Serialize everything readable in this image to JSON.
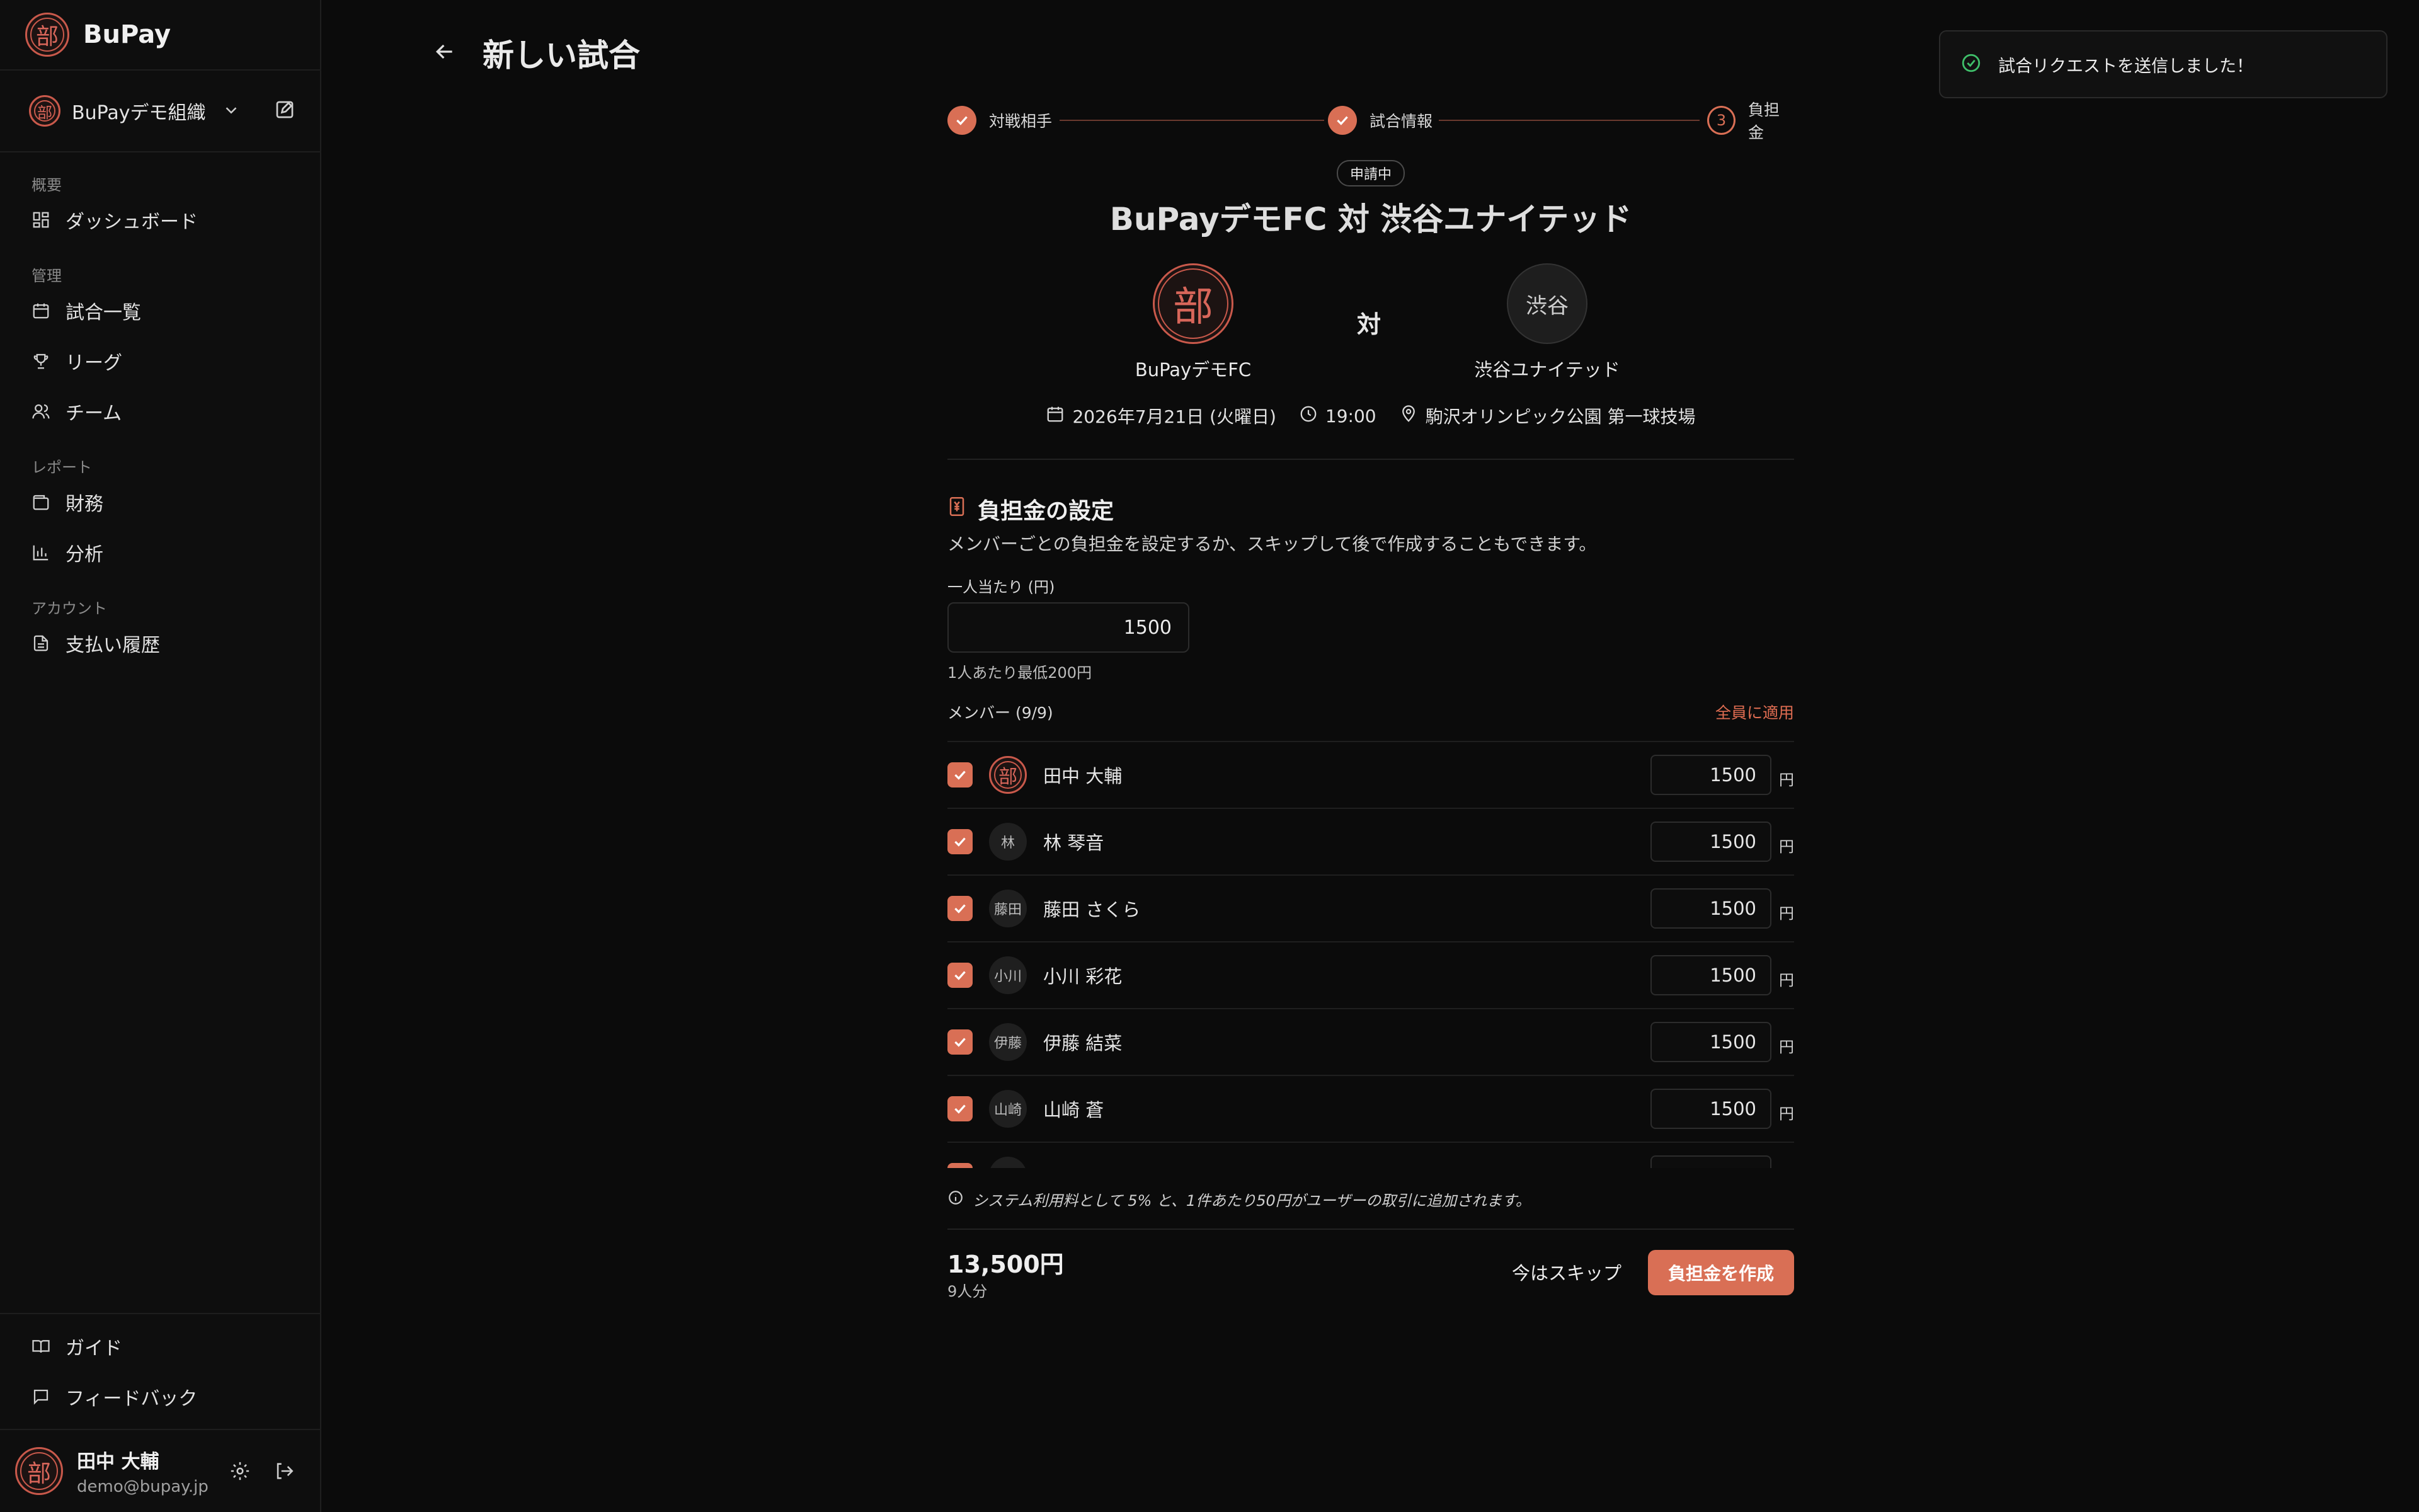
{
  "app": {
    "brand": "BuPay",
    "logo_char": "部"
  },
  "sidebar": {
    "org_name": "BuPayデモ組織",
    "sections": {
      "overview": "概要",
      "manage": "管理",
      "report": "レポート",
      "account": "アカウント"
    },
    "items": {
      "dashboard": "ダッシュボード",
      "matches": "試合一覧",
      "league": "リーグ",
      "team": "チーム",
      "finance": "財務",
      "analytics": "分析",
      "payments": "支払い履歴",
      "guide": "ガイド",
      "feedback": "フィードバック"
    },
    "user": {
      "name": "田中 大輔",
      "email": "demo@bupay.jp"
    }
  },
  "header": {
    "title": "新しい試合"
  },
  "toast": {
    "message": "試合リクエストを送信しました！"
  },
  "stepper": {
    "steps": [
      {
        "label": "対戦相手",
        "state": "done"
      },
      {
        "label": "試合情報",
        "state": "done"
      },
      {
        "label": "負担金",
        "state": "current",
        "number": "3"
      }
    ]
  },
  "match": {
    "status": "申請中",
    "title": "BuPayデモFC 対 渋谷ユナイテッド",
    "vs": "対",
    "home": {
      "name": "BuPayデモFC",
      "avatar": "部"
    },
    "away": {
      "name": "渋谷ユナイテッド",
      "avatar": "渋谷"
    },
    "date": "2026年7月21日 (火曜日)",
    "time": "19:00",
    "venue": "駒沢オリンピック公園 第一球技場"
  },
  "fees": {
    "title": "負担金の設定",
    "description": "メンバーごとの負担金を設定するか、スキップして後で作成することもできます。",
    "per_person_label": "一人当たり (円)",
    "per_person_value": "1500",
    "hint": "1人あたり最低200円",
    "members_label": "メンバー (9/9)",
    "apply_all": "全員に適用",
    "unit": "円",
    "members": [
      {
        "name": "田中 大輔",
        "avatar": "部",
        "amount": "1500",
        "seal": true
      },
      {
        "name": "林 琴音",
        "avatar": "林",
        "amount": "1500"
      },
      {
        "name": "藤田 さくら",
        "avatar": "藤田",
        "amount": "1500"
      },
      {
        "name": "小川 彩花",
        "avatar": "小川",
        "amount": "1500"
      },
      {
        "name": "伊藤 結菜",
        "avatar": "伊藤",
        "amount": "1500"
      },
      {
        "name": "山崎 蒼",
        "avatar": "山崎",
        "amount": "1500"
      },
      {
        "name": "",
        "avatar": "",
        "amount": ""
      }
    ],
    "fee_note": "システム利用料として 5% と、1件あたり50円がユーザーの取引に追加されます。",
    "total": "13,500円",
    "total_sub": "9人分",
    "skip_label": "今はスキップ",
    "create_label": "負担金を作成"
  },
  "colors": {
    "accent": "#d96f55",
    "seal": "#c9594b",
    "success": "#3fbf6a",
    "background": "#0b0b0b"
  }
}
